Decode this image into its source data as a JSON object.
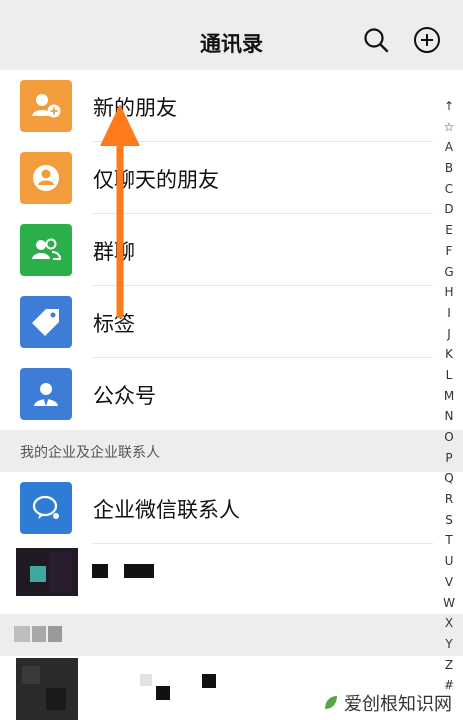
{
  "header": {
    "title": "通讯录",
    "search_icon": "search-icon",
    "add_icon": "add-icon"
  },
  "contacts_top": [
    {
      "label": "新的朋友",
      "icon": "add-friend-icon",
      "color": "#F39C3C"
    },
    {
      "label": "仅聊天的朋友",
      "icon": "chat-friend-icon",
      "color": "#F39C3C"
    },
    {
      "label": "群聊",
      "icon": "group-chat-icon",
      "color": "#2BAF4A"
    },
    {
      "label": "标签",
      "icon": "tag-icon",
      "color": "#3D7DD8"
    },
    {
      "label": "公众号",
      "icon": "official-account-icon",
      "color": "#3D7DD8"
    }
  ],
  "section_enterprise": {
    "label": "我的企业及企业联系人"
  },
  "enterprise_item": {
    "label": "企业微信联系人",
    "icon": "wecom-icon",
    "color": "#2F7CD6"
  },
  "index": [
    "↑",
    "☆",
    "A",
    "B",
    "C",
    "D",
    "E",
    "F",
    "G",
    "H",
    "I",
    "J",
    "K",
    "L",
    "M",
    "N",
    "O",
    "P",
    "Q",
    "R",
    "S",
    "T",
    "U",
    "V",
    "W",
    "X",
    "Y",
    "Z",
    "#"
  ],
  "watermark": {
    "text": "爱创根知识网"
  }
}
